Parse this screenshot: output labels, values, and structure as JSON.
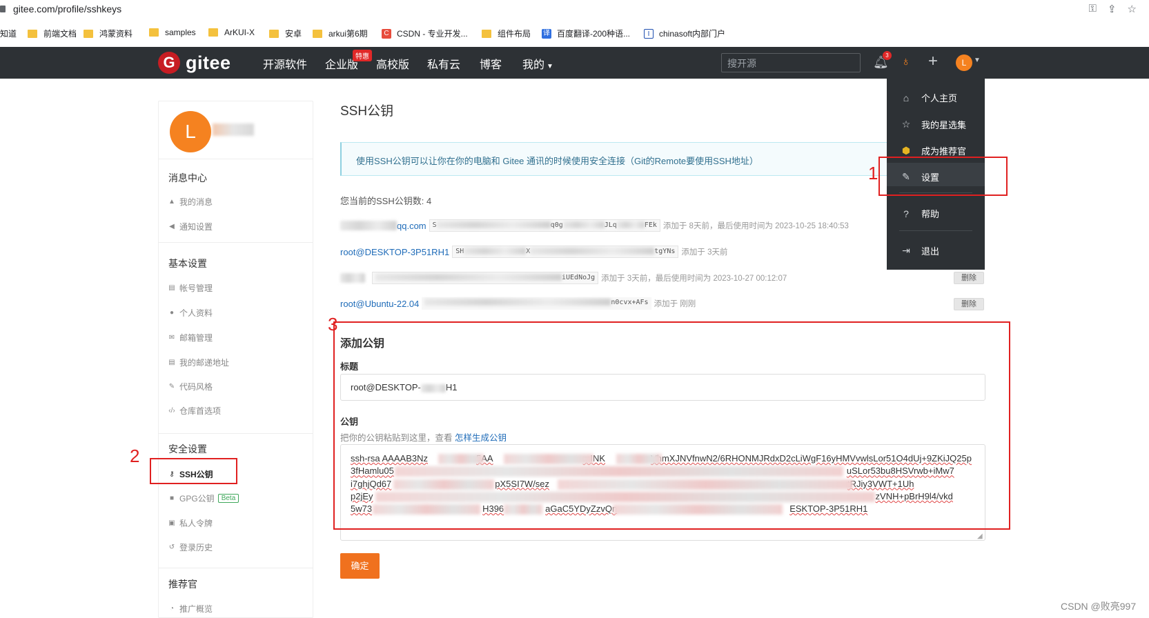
{
  "browser": {
    "url": "gitee.com/profile/sshkeys",
    "bookmarks": [
      "知道",
      "前端文档",
      "鸿蒙资料",
      "samples",
      "ArKUI-X",
      "安卓",
      "arkui第6期",
      "CSDN - 专业开发...",
      "组件布局",
      "百度翻译-200种语...",
      "chinasoft内部门户"
    ]
  },
  "nav": {
    "brand": "gitee",
    "items": [
      "开源软件",
      "企业版",
      "高校版",
      "私有云",
      "博客",
      "我的"
    ],
    "promo_badge": "特惠",
    "search_placeholder": "搜开源",
    "notif_count": "3",
    "avatar_letter": "L"
  },
  "sidebar": {
    "avatar_letter": "L",
    "sections": [
      {
        "title": "消息中心",
        "items": [
          "我的消息",
          "通知设置"
        ]
      },
      {
        "title": "基本设置",
        "items": [
          "帐号管理",
          "个人资料",
          "邮箱管理",
          "我的邮递地址",
          "代码风格",
          "仓库首选项"
        ]
      },
      {
        "title": "安全设置",
        "items": [
          "SSH公钥",
          "GPG公钥",
          "私人令牌",
          "登录历史"
        ]
      },
      {
        "title": "推荐官",
        "items": [
          "推广概览"
        ]
      }
    ],
    "beta_badge": "Beta",
    "active_item": "SSH公钥"
  },
  "main": {
    "title": "SSH公钥",
    "tip": "使用SSH公钥可以让你在你的电脑和 Gitee 通讯的时候使用安全连接（Git的Remote要使用SSH地址）",
    "count_text": "您当前的SSH公钥数: 4",
    "keys": [
      {
        "title": "qq.com",
        "fp_start": "S",
        "fp_mid": "q0g",
        "fp_mid2": "JLq",
        "fp_end": "FEk",
        "time": "添加于 8天前，最后使用时间为 2023-10-25 18:40:53"
      },
      {
        "title": "root@DESKTOP-3P51RH1",
        "fp_start": "SH",
        "fp_mid": "X",
        "fp_end": "tgYNs",
        "time": "添加于 3天前"
      },
      {
        "title": "",
        "fp_end": "iUEdNoJg",
        "time": "添加于 3天前，最后使用时间为 2023-10-27 00:12:07",
        "delete": "删除"
      },
      {
        "title": "root@Ubuntu-22.04",
        "fp_end": "n0cvx+AFs",
        "time": "添加于 刚刚",
        "delete": "删除"
      }
    ],
    "add_title": "添加公钥",
    "field_title_label": "标题",
    "field_title_value_a": "root@DESKTOP-",
    "field_title_value_b": "H1",
    "field_key_label": "公钥",
    "hint_prefix": "把你的公钥粘贴到这里，查看",
    "hint_link": "怎样生成公钥",
    "key_lines": [
      {
        "a": "ssh-rsa AAAAB3Nz",
        "b": "5AA",
        "c": "mINK",
        "d": "VhmXJNVfnwN2/6RHONMJRdxD2cLiWgF16yHMVvwlsLor51O4dUj+9ZKiJQ25p"
      },
      {
        "a": "3fHamlu05",
        "b": "",
        "c": "",
        "d": "uSLor53bu8HSVrwb+iMw7"
      },
      {
        "a": "i7ghjQd67",
        "b": "pX5SI7W/sez",
        "c": "",
        "d": "tRJiy3VWT+1Uh"
      },
      {
        "a": "p2jEy",
        "b": "",
        "c": "",
        "d": "zVNH+pBrH9l4/vkd"
      },
      {
        "a": "5w73",
        "b": "H396",
        "c": "aGaC5YDyZzvQn",
        "d": "ESKTOP-3P51RH1"
      }
    ],
    "confirm": "确定"
  },
  "dropdown": {
    "items": [
      "个人主页",
      "我的星选集",
      "成为推荐官",
      "设置",
      "帮助",
      "退出"
    ]
  },
  "annotations": [
    "1",
    "2",
    "3"
  ],
  "watermark": "CSDN @败亮997"
}
